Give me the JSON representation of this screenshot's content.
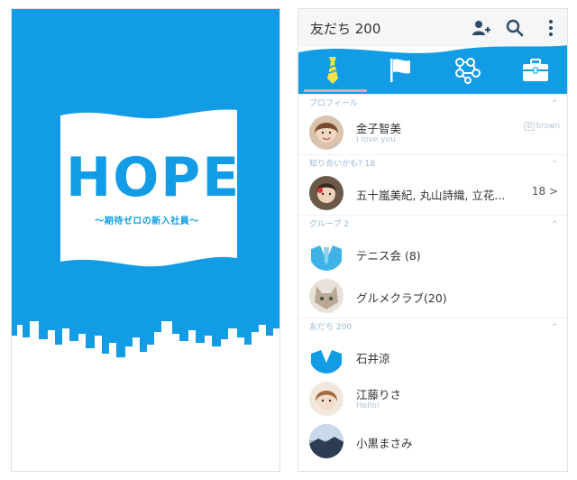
{
  "splash": {
    "title": "HOPE",
    "subtitle": "～期待ゼロの新入社員～"
  },
  "header": {
    "title": "友だち 200",
    "icons": [
      "add-friend-icon",
      "search-icon",
      "more-vert-icon"
    ]
  },
  "tabs": [
    {
      "name": "necktie-tab",
      "active": true
    },
    {
      "name": "flag-tab",
      "active": false
    },
    {
      "name": "network-tab",
      "active": false
    },
    {
      "name": "briefcase-tab",
      "active": false
    }
  ],
  "profile": {
    "section_label": "プロフィール",
    "name": "金子智美",
    "status": "I love you",
    "badge": "brown",
    "badge_icon": "ID"
  },
  "suggestions": {
    "section_label": "知り合いかも? 18",
    "names": "五十嵐美紀, 丸山詩織, 立花...",
    "count": "18 >"
  },
  "groups": {
    "section_label": "グループ 2",
    "items": [
      {
        "name": "テニス会 (8)"
      },
      {
        "name": "グルメクラブ(20)"
      }
    ]
  },
  "friends": {
    "section_label": "友だち 200",
    "items": [
      {
        "name": "石井涼",
        "status": ""
      },
      {
        "name": "江藤りさ",
        "status": "Hello!"
      },
      {
        "name": "小黒まさみ",
        "status": ""
      }
    ]
  },
  "colors": {
    "brand_blue": "#139ce6",
    "tab_underline": "#f09cc3",
    "section_text": "#9bb9d6"
  }
}
